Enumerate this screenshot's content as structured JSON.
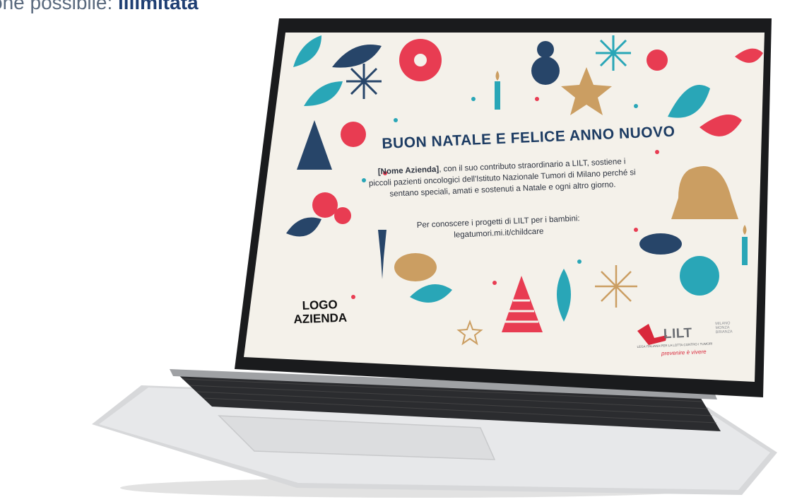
{
  "header": {
    "prefix": "one possibile: ",
    "emphasis": "illimitata"
  },
  "card": {
    "title": "BUON NATALE E FELICE ANNO NUOVO",
    "company_placeholder": "[Nome Azienda]",
    "body_rest": ", con il suo contributo straordinario a LILT, sostiene i piccoli pazienti oncologici dell'Istituto Nazionale Tumori di Milano perché si sentano speciali, amati e sostenuti a Natale e ogni altro giorno.",
    "projects_line": "Per conoscere i progetti di LILT per i bambini:",
    "projects_url": "legatumori.mi.it/childcare",
    "logo_line1": "LOGO",
    "logo_line2": "AZIENDA"
  },
  "brand": {
    "name": "LILT",
    "city": "MILANO MONZA BRIANZA",
    "full_name": "LEGA ITALIANA PER LA LOTTA CONTRO I TUMORI",
    "motto": "prevenire è vivere"
  },
  "colors": {
    "navy": "#1d3c63",
    "red": "#e8334a",
    "teal": "#1fa3b5",
    "gold": "#c99a5b",
    "cream": "#f4f1ea"
  },
  "icons": [
    "star-icon",
    "snowflake-icon",
    "snowman-icon",
    "candle-icon",
    "bell-icon",
    "tree-icon",
    "ornament-icon",
    "glass-icon"
  ]
}
